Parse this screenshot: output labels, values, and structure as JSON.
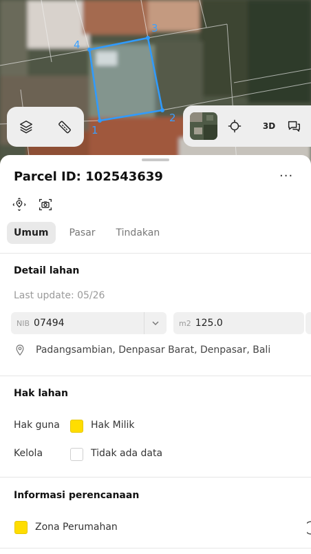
{
  "map": {
    "corner_labels": [
      "1",
      "2",
      "3",
      "4"
    ],
    "parcel_color": "#2f9bff"
  },
  "map_tools": {
    "left": [
      {
        "icon": "layers-icon"
      },
      {
        "icon": "ruler-icon"
      }
    ],
    "right": [
      {
        "icon": "satellite-thumbnail"
      },
      {
        "icon": "locate-icon"
      },
      {
        "label": "3D"
      },
      {
        "icon": "chat-icon"
      }
    ]
  },
  "sheet": {
    "title": "Parcel ID: 102543639",
    "more_label": "···",
    "actions": [
      {
        "icon": "focus-location-icon"
      },
      {
        "icon": "screenshot-icon"
      }
    ],
    "tabs": [
      {
        "label": "Umum",
        "active": true
      },
      {
        "label": "Pasar",
        "active": false
      },
      {
        "label": "Tindakan",
        "active": false
      }
    ]
  },
  "detail": {
    "title": "Detail lahan",
    "last_update": "Last update: 05/26",
    "nib_label": "NIB",
    "nib_value": "07494",
    "area_label": "m2",
    "area_value": "125.0",
    "address": "Padangsambian, Denpasar Barat, Denpasar, Bali"
  },
  "rights": {
    "title": "Hak lahan",
    "rows": [
      {
        "label": "Hak guna",
        "value": "Hak Milik",
        "swatch": "#ffdd00"
      },
      {
        "label": "Kelola",
        "value": "Tidak ada data",
        "swatch": "#ffffff"
      }
    ]
  },
  "planning": {
    "title": "Informasi perencanaan",
    "zone": "Zona Perumahan",
    "zone_color": "#ffdd00"
  }
}
